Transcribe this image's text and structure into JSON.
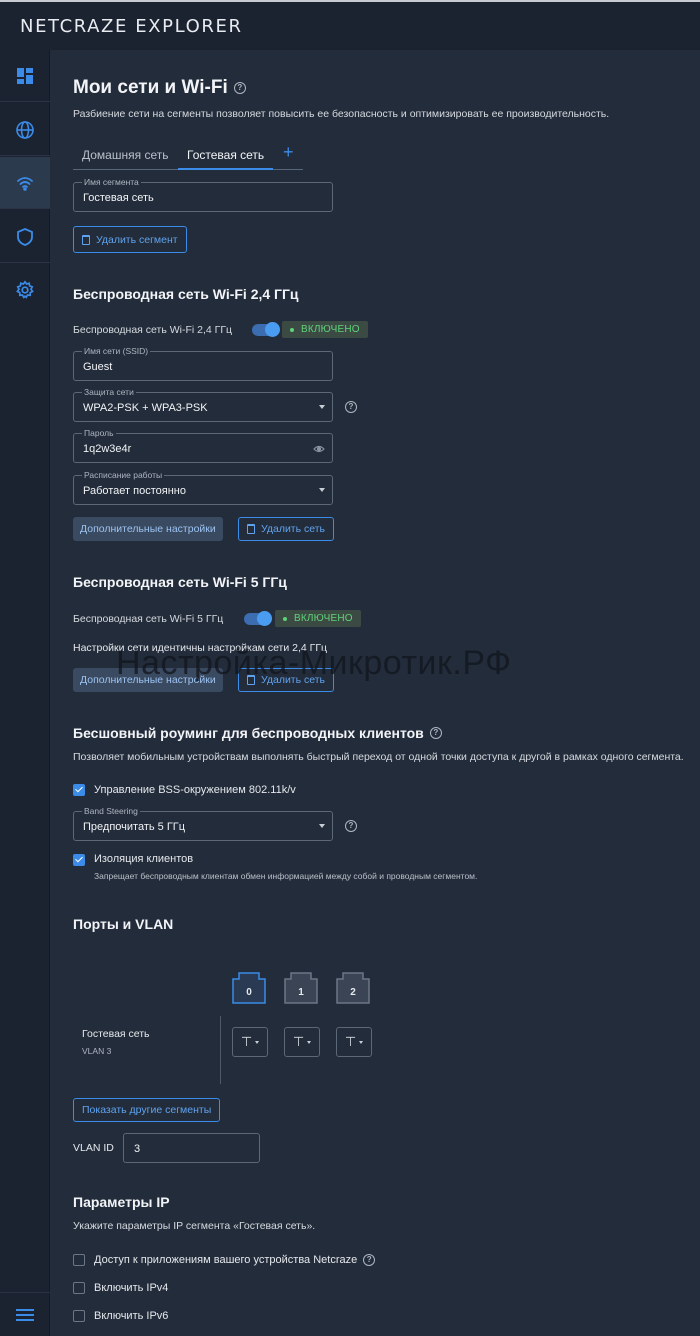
{
  "app": {
    "logo": "NETCRAZE EXPLORER"
  },
  "sidebar": {
    "items": [
      {
        "name": "dashboard-icon"
      },
      {
        "name": "globe-icon"
      },
      {
        "name": "wifi-icon",
        "active": true
      },
      {
        "name": "shield-icon"
      },
      {
        "name": "gear-icon"
      }
    ],
    "menu_icon": "hamburger-icon"
  },
  "page": {
    "title": "Мои сети и Wi-Fi",
    "description": "Разбиение сети на сегменты позволяет повысить ее безопасность и оптимизировать ее производительность.",
    "tabs": [
      {
        "label": "Домашняя сеть",
        "active": false
      },
      {
        "label": "Гостевая сеть",
        "active": true
      }
    ],
    "tab_add": "+"
  },
  "segment": {
    "name_label": "Имя сегмента",
    "name_value": "Гостевая сеть",
    "delete_label": "Удалить сегмент"
  },
  "wifi24": {
    "heading": "Беспроводная сеть Wi-Fi 2,4 ГГц",
    "toggle_label": "Беспроводная сеть Wi-Fi 2,4 ГГц",
    "status": "ВКЛЮЧЕНО",
    "ssid_label": "Имя сети (SSID)",
    "ssid_value": "Guest",
    "security_label": "Защита сети",
    "security_value": "WPA2-PSK + WPA3-PSK",
    "password_label": "Пароль",
    "password_value": "1q2w3e4r",
    "schedule_label": "Расписание работы",
    "schedule_value": "Работает постоянно",
    "advanced_label": "Дополнительные настройки",
    "delete_label": "Удалить сеть"
  },
  "wifi5": {
    "heading": "Беспроводная сеть Wi-Fi 5 ГГц",
    "toggle_label": "Беспроводная сеть Wi-Fi 5 ГГц",
    "status": "ВКЛЮЧЕНО",
    "same_settings": "Настройки сети идентичны настройкам сети 2,4 ГГц",
    "advanced_label": "Дополнительные настройки",
    "delete_label": "Удалить сеть"
  },
  "watermark": "Настройка-Микротик.РФ",
  "roaming": {
    "heading": "Бесшовный роуминг для беспроводных клиентов",
    "description": "Позволяет мобильным устройствам выполнять быстрый переход от одной точки доступа к другой в рамках одного сегмента.",
    "bss_label": "Управление BSS-окружением 802.11k/v",
    "bss_checked": true,
    "band_label": "Band Steering",
    "band_value": "Предпочитать 5 ГГц",
    "isolation_label": "Изоляция клиентов",
    "isolation_checked": true,
    "isolation_desc": "Запрещает беспроводным клиентам обмен информацией между собой и проводным сегментом."
  },
  "ports": {
    "heading": "Порты и VLAN",
    "port_labels": [
      "0",
      "1",
      "2"
    ],
    "segment_name": "Гостевая сеть",
    "segment_vlan": "VLAN 3",
    "tag_symbol": "⊤",
    "show_others": "Показать другие сегменты",
    "vlan_id_label": "VLAN ID",
    "vlan_id_value": "3"
  },
  "ip": {
    "heading": "Параметры IP",
    "description": "Укажите параметры IP сегмента «Гостевая сеть».",
    "options": [
      {
        "label": "Доступ к приложениям вашего устройства Netcraze",
        "checked": false
      },
      {
        "label": "Включить IPv4",
        "checked": false
      },
      {
        "label": "Включить IPv6",
        "checked": false
      }
    ]
  },
  "colors": {
    "accent": "#3b8be8",
    "status_on": "#5fd37a",
    "background": "#232c3a",
    "sidebar": "#1b2230"
  }
}
